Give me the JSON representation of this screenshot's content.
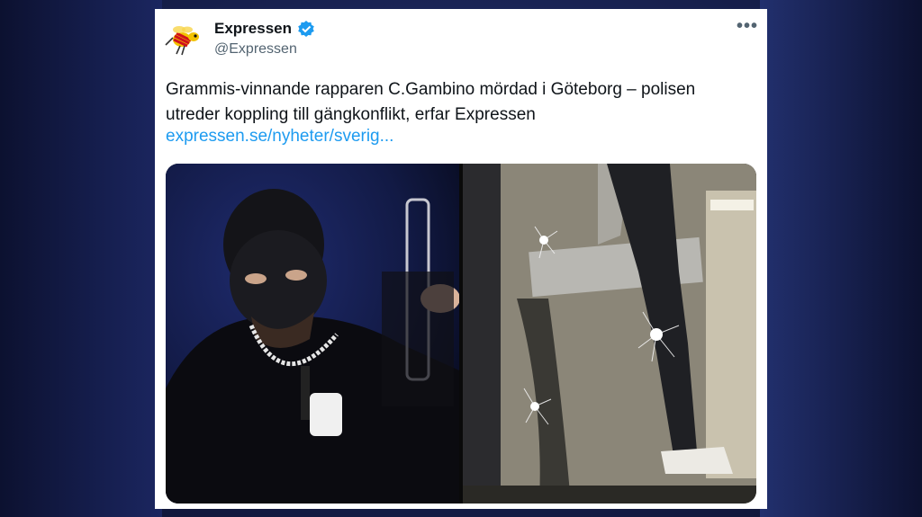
{
  "tweet": {
    "author_name": "Expressen",
    "handle": "@Expressen",
    "text": "Grammis-vinnande rapparen C.Gambino mördad i Göteborg – polisen utreder koppling till gängkonflikt, erfar Expressen",
    "link_text": "expressen.se/nyheter/sverig...",
    "more_glyph": "•••"
  },
  "colors": {
    "link": "#1d9bf0",
    "verified": "#1d9bf0",
    "text": "#0f1419",
    "muted": "#536471"
  },
  "icons": {
    "avatar": "wasp-logo",
    "verified": "verified-badge-icon",
    "more": "more-options-icon"
  }
}
